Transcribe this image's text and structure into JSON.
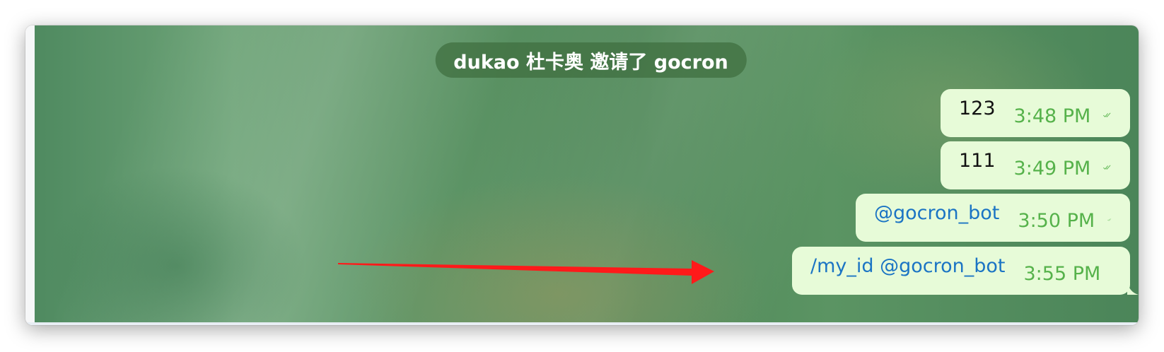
{
  "service_message": "dukao 杜卡奥 邀请了 gocron",
  "messages": [
    {
      "text": "123",
      "time": "3:48 PM",
      "status": "double-check-icon",
      "is_link": false
    },
    {
      "text": "111",
      "time": "3:49 PM",
      "status": "double-check-icon",
      "is_link": false
    },
    {
      "text": "@gocron_bot",
      "time": "3:50 PM",
      "status": "double-check-icon",
      "is_link": true
    },
    {
      "text": "/my_id @gocron_bot",
      "time": "3:55 PM",
      "status": "single-check-icon",
      "is_link": true
    }
  ],
  "colors": {
    "bubble": "#e7fbd8",
    "time": "#56b24b",
    "link": "#1b74c4",
    "annotation_arrow": "#ff1a1a"
  }
}
